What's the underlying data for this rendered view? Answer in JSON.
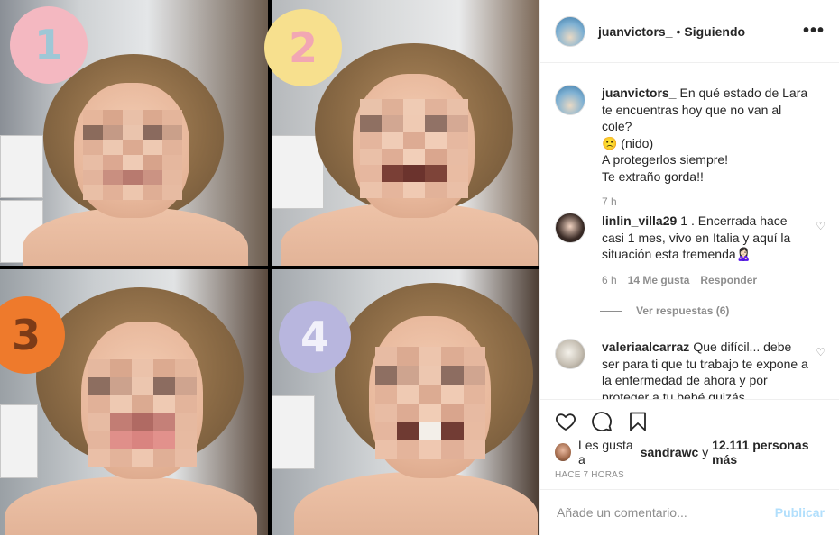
{
  "header": {
    "username": "juanvictors_",
    "separator": "•",
    "follow_status": "Siguiendo",
    "more_icon": "ellipsis-icon"
  },
  "caption": {
    "username": "juanvictors_",
    "line1": "En qué estado de Lara te encuentras hoy que no van al cole?",
    "line2": "🙁 (nido)",
    "line3": "A protegerlos siempre!",
    "line4": "Te extraño gorda!!",
    "time": "7 h"
  },
  "comments": [
    {
      "username": "linlin_villa29",
      "text": "1 . Encerrada hace casi 1 mes, vivo en Italia y aquí la situación esta tremenda🙎🏻‍♀️",
      "time": "6 h",
      "likes": "14 Me gusta",
      "reply": "Responder"
    },
    {
      "username": "valeriaalcarraz",
      "text": "Que difícil... debe ser para ti que tu trabajo te expone a la enfermedad de ahora y por proteger a tu bebé quizás"
    }
  ],
  "replies_link": "Ver respuestas (6)",
  "actions": {
    "like_icon": "heart-icon",
    "comment_icon": "comment-icon",
    "save_icon": "bookmark-icon"
  },
  "likes": {
    "prefix": "Les gusta a",
    "user": "sandrawc",
    "middle": "y",
    "count": "12.111 personas más"
  },
  "timestamp": "HACE 7 HORAS",
  "add_comment": {
    "placeholder": "Añade un comentario...",
    "publish": "Publicar"
  },
  "badges": [
    "1",
    "2",
    "3",
    "4"
  ],
  "colors": {
    "link_disabled": "#b2dffc",
    "secondary_text": "#8e8e8e",
    "border": "#efefef"
  }
}
